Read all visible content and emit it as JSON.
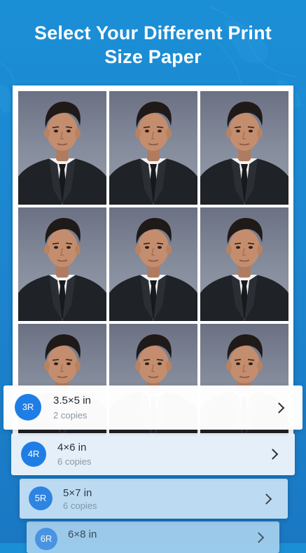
{
  "header": {
    "title_line1": "Select Your Different Print",
    "title_line2": "Size Paper"
  },
  "preview": {
    "rows": 3,
    "columns": 3
  },
  "print_sizes": [
    {
      "badge": "3R",
      "size": "3.5×5 in",
      "copies": "2 copies"
    },
    {
      "badge": "4R",
      "size": "4×6 in",
      "copies": "6 copies"
    },
    {
      "badge": "5R",
      "size": "5×7 in",
      "copies": "6 copies"
    },
    {
      "badge": "6R",
      "size": "6×8 in"
    }
  ],
  "colors": {
    "background": "#1b8fd6",
    "badge": "#1f7ee6",
    "photo_background": "#858c9c",
    "suit": "#1f2226"
  },
  "icons": {
    "card_arrow": "chevron-right-icon"
  }
}
